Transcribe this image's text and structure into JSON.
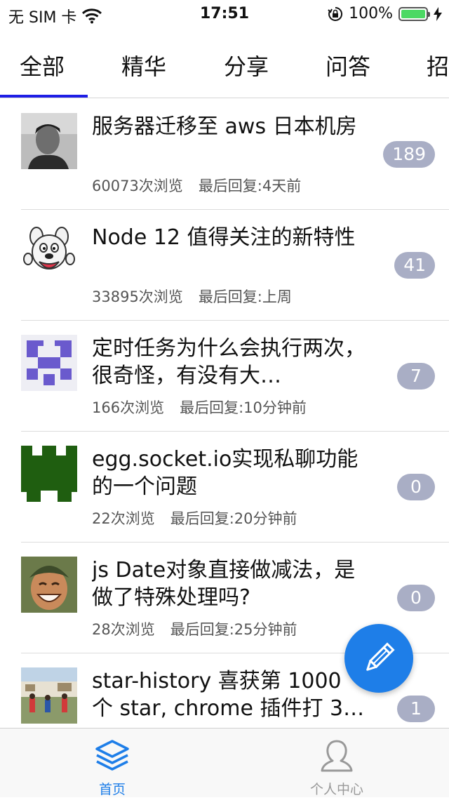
{
  "status_bar": {
    "carrier": "无 SIM 卡",
    "time": "17:51",
    "battery": "100%",
    "battery_level": 1.0,
    "icons": [
      "wifi-icon",
      "orientation-lock-icon",
      "charging-icon"
    ]
  },
  "tabs": [
    {
      "label": "全部",
      "active": true
    },
    {
      "label": "精华",
      "active": false
    },
    {
      "label": "分享",
      "active": false
    },
    {
      "label": "问答",
      "active": false
    },
    {
      "label": "招",
      "active": false
    }
  ],
  "topics": [
    {
      "title": "服务器迁移至 aws 日本机房",
      "views": "60073次浏览",
      "last_reply": "最后回复:4天前",
      "reply_count": "189",
      "avatar": "photo-avatar"
    },
    {
      "title": "Node 12 值得关注的新特性",
      "views": "33895次浏览",
      "last_reply": "最后回复:上周",
      "reply_count": "41",
      "avatar": "cartoon-dog-avatar"
    },
    {
      "title": "定时任务为什么会执行两次，很奇怪，有没有大…",
      "views": "166次浏览",
      "last_reply": "最后回复:10分钟前",
      "reply_count": "7",
      "avatar": "purple-identicon-avatar"
    },
    {
      "title": "egg.socket.io实现私聊功能的一个问题",
      "views": "22次浏览",
      "last_reply": "最后回复:20分钟前",
      "reply_count": "0",
      "avatar": "green-identicon-avatar"
    },
    {
      "title": "js Date对象直接做减法，是做了特殊处理吗?",
      "views": "28次浏览",
      "last_reply": "最后回复:25分钟前",
      "reply_count": "0",
      "avatar": "smiling-kid-avatar"
    },
    {
      "title": "star-history 喜获第 1000 个 star, chrome 插件打 3…",
      "views": "",
      "last_reply": "",
      "reply_count": "1",
      "avatar": "basketball-photo-avatar"
    }
  ],
  "fab": {
    "icon": "pencil-icon"
  },
  "bottom_nav": [
    {
      "label": "首页",
      "icon": "layers-icon",
      "active": true
    },
    {
      "label": "个人中心",
      "icon": "user-icon",
      "active": false
    }
  ],
  "colors": {
    "accent": "#1e7ee8",
    "tab_indicator": "#1e1ee6",
    "badge": "#a9aec5",
    "nav_inactive": "#999999",
    "battery": "#4cd964"
  }
}
